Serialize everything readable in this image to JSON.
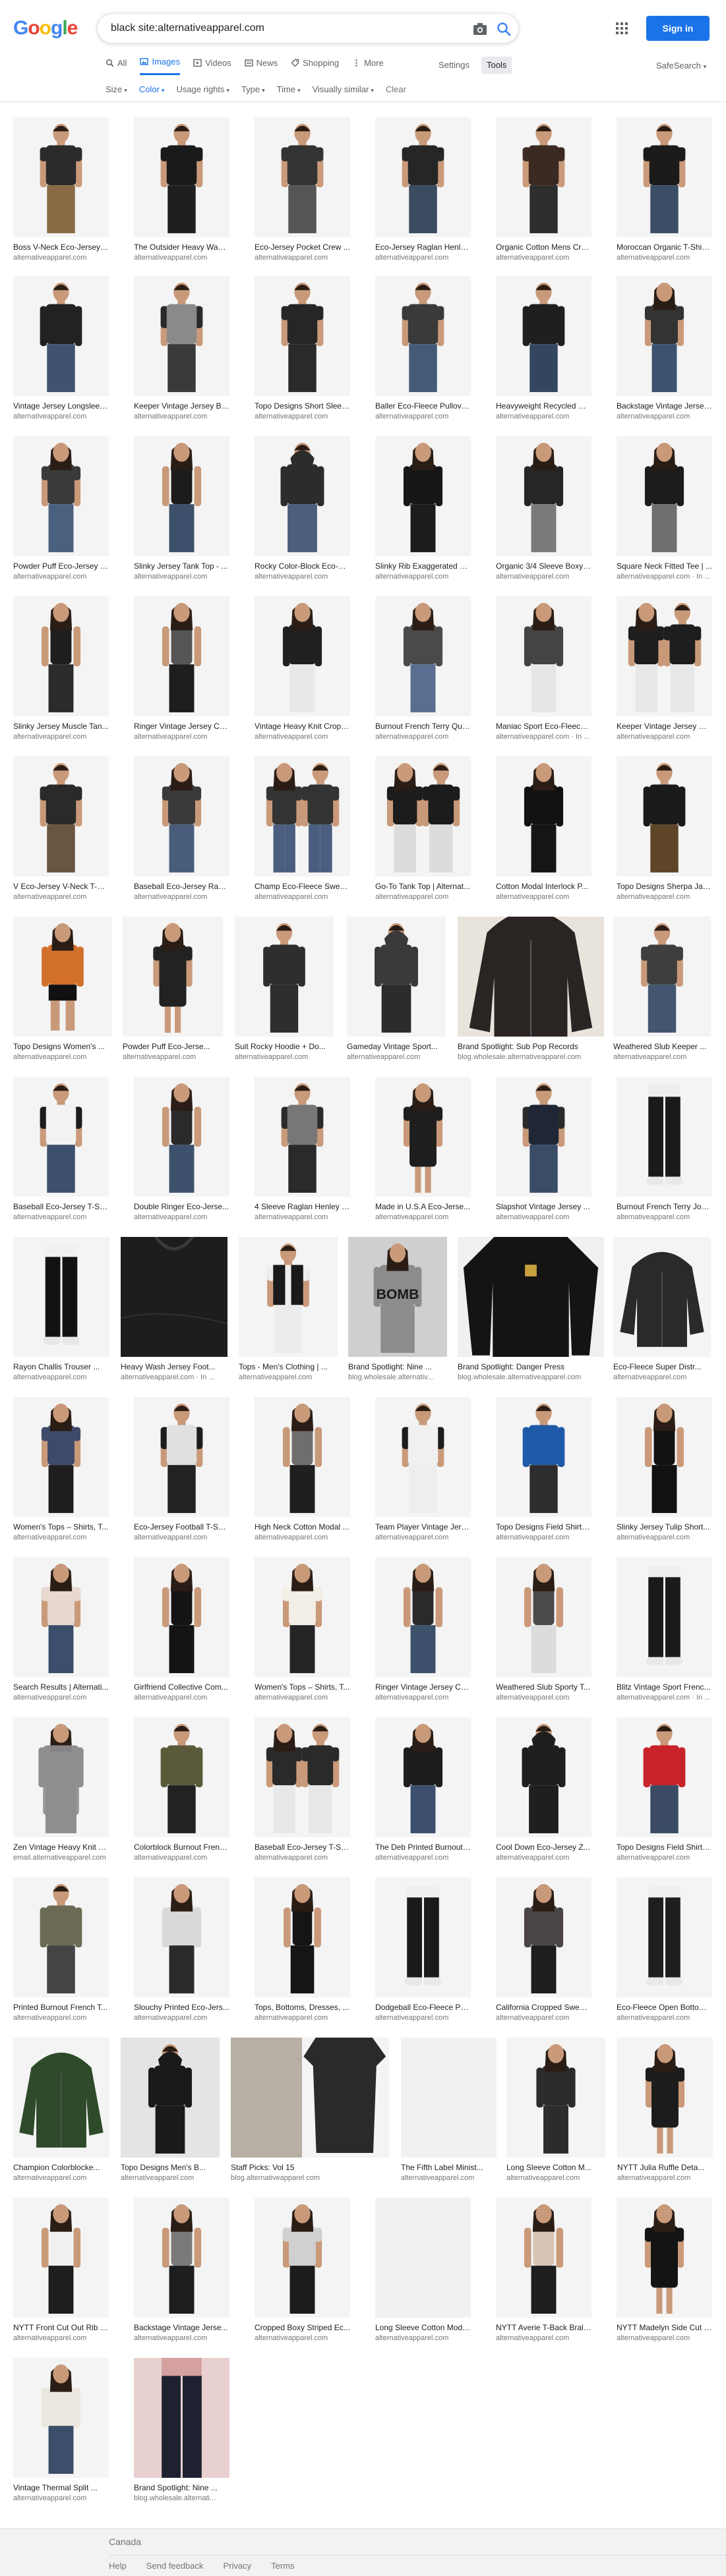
{
  "logo": {
    "letters": [
      [
        "G",
        "#4285f4"
      ],
      [
        "o",
        "#ea4335"
      ],
      [
        "o",
        "#fbbc05"
      ],
      [
        "g",
        "#4285f4"
      ],
      [
        "l",
        "#34a853"
      ],
      [
        "e",
        "#ea4335"
      ]
    ]
  },
  "search": {
    "query": "black site:alternativeapparel.com"
  },
  "header": {
    "signin_label": "Sign in"
  },
  "tabs": [
    {
      "label": "All",
      "icon": "search-icon",
      "active": false
    },
    {
      "label": "Images",
      "icon": "image-icon",
      "active": true
    },
    {
      "label": "Videos",
      "icon": "video-icon",
      "active": false
    },
    {
      "label": "News",
      "icon": "news-icon",
      "active": false
    },
    {
      "label": "Shopping",
      "icon": "tag-icon",
      "active": false
    },
    {
      "label": "More",
      "icon": "more-icon",
      "active": false
    }
  ],
  "tools": {
    "settings": "Settings",
    "tools": "Tools",
    "safesearch": "SafeSearch"
  },
  "filters": [
    {
      "label": "Size",
      "selected": false
    },
    {
      "label": "Color",
      "selected": true
    },
    {
      "label": "Usage rights",
      "selected": false
    },
    {
      "label": "Type",
      "selected": false
    },
    {
      "label": "Time",
      "selected": false
    },
    {
      "label": "Visually similar",
      "selected": false
    }
  ],
  "clear_label": "Clear",
  "rows": [
    [
      {
        "cap": "Boss V-Neck Eco-Jersey ...",
        "src": "alternativeapparel.com",
        "kind": "tee",
        "shirt": "#2b2b2b",
        "pants": "#8a6b45",
        "bg": "#f4f4f4"
      },
      {
        "cap": "The Outsider Heavy Wash...",
        "src": "alternativeapparel.com",
        "kind": "tee",
        "shirt": "#1a1a1a",
        "pants": "#1f1f1f",
        "bg": "#f4f4f4"
      },
      {
        "cap": "Eco-Jersey Pocket Crew ...",
        "src": "alternativeapparel.com",
        "kind": "tee",
        "shirt": "#333333",
        "pants": "#555555",
        "bg": "#f4f4f4"
      },
      {
        "cap": "Eco-Jersey Raglan Henle...",
        "src": "alternativeapparel.com",
        "kind": "tee",
        "shirt": "#262626",
        "pants": "#3a4a60",
        "bg": "#f4f4f4"
      },
      {
        "cap": "Organic Cotton Mens Cre...",
        "src": "alternativeapparel.com",
        "kind": "tee",
        "shirt": "#3b2a22",
        "pants": "#2d2d2d",
        "bg": "#f4f4f4"
      },
      {
        "cap": "Moroccan Organic T-Shirt...",
        "src": "alternativeapparel.com",
        "kind": "tee",
        "shirt": "#1b1b1b",
        "pants": "#3c4e66",
        "bg": "#f4f4f4"
      }
    ],
    [
      {
        "cap": "Vintage Jersey Longsleev...",
        "src": "alternativeapparel.com",
        "kind": "long",
        "shirt": "#222222",
        "pants": "#3f5270",
        "bg": "#f4f4f4"
      },
      {
        "cap": "Keeper Vintage Jersey Ba...",
        "src": "alternativeapparel.com",
        "kind": "raglan",
        "shirt": "#8a8a8a",
        "pants": "#3a3a3a",
        "bg": "#f4f4f4"
      },
      {
        "cap": "Topo Designs Short Sleev...",
        "src": "alternativeapparel.com",
        "kind": "tee",
        "shirt": "#262626",
        "pants": "#2a2a2a",
        "bg": "#f4f4f4"
      },
      {
        "cap": "Baller Eco-Fleece Pullove...",
        "src": "alternativeapparel.com",
        "kind": "tee",
        "shirt": "#3a3a3a",
        "pants": "#455a78",
        "bg": "#f4f4f4"
      },
      {
        "cap": "Heavyweight Recycled Co...",
        "src": "alternativeapparel.com",
        "kind": "long",
        "shirt": "#1f1f1f",
        "pants": "#34465f",
        "bg": "#f4f4f4"
      },
      {
        "cap": "Backstage Vintage Jersey...",
        "src": "alternativeapparel.com",
        "kind": "woman",
        "shirt": "#333333",
        "pants": "#3d5270",
        "bg": "#f4f4f4"
      }
    ],
    [
      {
        "cap": "Powder Puff Eco-Jersey T...",
        "src": "alternativeapparel.com",
        "kind": "woman",
        "shirt": "#3a3a3a",
        "pants": "#4a607f",
        "bg": "#f4f4f4"
      },
      {
        "cap": "Slinky Jersey Tank Top - ...",
        "src": "alternativeapparel.com",
        "kind": "tank",
        "shirt": "#1c1c1c",
        "pants": "#3c4f6b",
        "bg": "#f4f4f4"
      },
      {
        "cap": "Rocky Color-Block Eco-Fl...",
        "src": "alternativeapparel.com",
        "kind": "hoodie",
        "shirt": "#2c2c2c",
        "pants": "#4b5e7c",
        "bg": "#f4f4f4"
      },
      {
        "cap": "Slinky Rib Exaggerated H...",
        "src": "alternativeapparel.com",
        "kind": "woman-long",
        "shirt": "#161616",
        "pants": "#1c1c1c",
        "bg": "#f4f4f4"
      },
      {
        "cap": "Organic 3/4 Sleeve Boxy ...",
        "src": "alternativeapparel.com",
        "kind": "woman-long",
        "shirt": "#262626",
        "pants": "#7a7a7a",
        "bg": "#f4f4f4"
      },
      {
        "cap": "Square Neck Fitted Tee | ...",
        "src": "alternativeapparel.com · In ...",
        "kind": "woman-long",
        "shirt": "#1c1c1c",
        "pants": "#6f6f6f",
        "bg": "#f4f4f4"
      }
    ],
    [
      {
        "cap": "Slinky Jersey Muscle Tan...",
        "src": "alternativeapparel.com",
        "kind": "tank",
        "shirt": "#1f1f1f",
        "pants": "#2b2b2b",
        "bg": "#f4f4f4"
      },
      {
        "cap": "Ringer Vintage Jersey Ca...",
        "src": "alternativeapparel.com",
        "kind": "tank",
        "shirt": "#555555",
        "pants": "#1e1e1e",
        "bg": "#f4f4f4"
      },
      {
        "cap": "Vintage Heavy Knit Cropp...",
        "src": "alternativeapparel.com",
        "kind": "woman-long",
        "shirt": "#202020",
        "pants": "#e8e8e8",
        "bg": "#f4f4f4"
      },
      {
        "cap": "Burnout French Terry Qua...",
        "src": "alternativeapparel.com",
        "kind": "woman-long",
        "shirt": "#4a4a4a",
        "pants": "#5a6f8f",
        "bg": "#f4f4f4"
      },
      {
        "cap": "Maniac Sport Eco-Fleece ...",
        "src": "alternativeapparel.com · In ...",
        "kind": "woman-long",
        "shirt": "#444444",
        "pants": "#e6e6e6",
        "bg": "#f4f4f4"
      },
      {
        "cap": "Keeper Vintage Jersey Cr...",
        "src": "alternativeapparel.com",
        "kind": "pair",
        "shirt": "#1e1e1e",
        "pants": "#e8e8e8",
        "bg": "#f4f4f4"
      }
    ],
    [
      {
        "cap": "V Eco-Jersey V-Neck T-S...",
        "src": "alternativeapparel.com",
        "kind": "tee",
        "shirt": "#2a2a2a",
        "pants": "#6a5540",
        "bg": "#f4f4f4"
      },
      {
        "cap": "Baseball Eco-Jersey Ragl...",
        "src": "alternativeapparel.com",
        "kind": "woman",
        "shirt": "#3a3a3a",
        "pants": "#485d7a",
        "bg": "#f4f4f4"
      },
      {
        "cap": "Champ Eco-Fleece Sweat...",
        "src": "alternativeapparel.com",
        "kind": "pair",
        "shirt": "#333333",
        "pants": "#4a5f7f",
        "bg": "#f4f4f4"
      },
      {
        "cap": "Go-To Tank Top | Alternat...",
        "src": "alternativeapparel.com",
        "kind": "pair",
        "shirt": "#1c1c1c",
        "pants": "#dcdcdc",
        "bg": "#f4f4f4"
      },
      {
        "cap": "Cotton Modal Interlock P...",
        "src": "alternativeapparel.com",
        "kind": "woman-long",
        "shirt": "#111111",
        "pants": "#151515",
        "bg": "#f4f4f4"
      },
      {
        "cap": "Topo Designs Sherpa Jac...",
        "src": "alternativeapparel.com",
        "kind": "long",
        "shirt": "#1a1a1a",
        "pants": "#5e4528",
        "bg": "#f4f4f4"
      }
    ],
    [
      {
        "cap": "Topo Designs Women's ...",
        "src": "alternativeapparel.com",
        "kind": "shorts",
        "shirt": "#d2702c",
        "pants": "#111111",
        "bg": "#f4f4f4"
      },
      {
        "cap": "Powder Puff Eco-Jerse...",
        "src": "alternativeapparel.com",
        "kind": "dress",
        "shirt": "#222222",
        "pants": "#222222",
        "bg": "#f4f4f4"
      },
      {
        "cap": "Suit Rocky Hoodie + Do...",
        "src": "alternativeapparel.com",
        "kind": "long",
        "shirt": "#2e2e2e",
        "pants": "#2e2e2e",
        "bg": "#f4f4f4"
      },
      {
        "cap": "Gameday Vintage Sport...",
        "src": "alternativeapparel.com",
        "kind": "hoodie",
        "shirt": "#3a3a3a",
        "pants": "#2c2c2c",
        "bg": "#f4f4f4"
      },
      {
        "cap": "Brand Spotlight: Sub Pop Records",
        "src": "blog.wholesale.alternativeapparel.com",
        "kind": "flat-hoodie",
        "shirt": "#2a2522",
        "pants": "#2a2522",
        "bg": "#e8e4dc"
      },
      {
        "cap": "Weathered Slub Keeper ...",
        "src": "alternativeapparel.com",
        "kind": "tee",
        "shirt": "#3e3e3e",
        "pants": "#42566f",
        "bg": "#f4f4f4"
      }
    ],
    [
      {
        "cap": "Baseball Eco-Jersey T-Sh...",
        "src": "alternativeapparel.com",
        "kind": "raglan",
        "shirt": "#f2f2f2",
        "pants": "#3d506b",
        "bg": "#f4f4f4"
      },
      {
        "cap": "Double Ringer Eco-Jerse...",
        "src": "alternativeapparel.com",
        "kind": "tank",
        "shirt": "#2a2a2a",
        "pants": "#3e516c",
        "bg": "#f4f4f4"
      },
      {
        "cap": "4 Sleeve Raglan Henley S...",
        "src": "alternativeapparel.com",
        "kind": "raglan",
        "shirt": "#777777",
        "pants": "#2a2a2a",
        "bg": "#f4f4f4"
      },
      {
        "cap": "Made in U.S.A Eco-Jerse...",
        "src": "alternativeapparel.com",
        "kind": "dress",
        "shirt": "#1e1e1e",
        "pants": "#1e1e1e",
        "bg": "#f4f4f4"
      },
      {
        "cap": "Slapshot Vintage Jersey ...",
        "src": "alternativeapparel.com",
        "kind": "raglan",
        "shirt": "#1f2636",
        "pants": "#3b4d66",
        "bg": "#f4f4f4"
      },
      {
        "cap": "Burnout French Terry Jog...",
        "src": "alternativeapparel.com",
        "kind": "jogger",
        "shirt": "#eeeeee",
        "pants": "#1a1a1a",
        "bg": "#f4f4f4"
      }
    ],
    [
      {
        "cap": "Rayon Challis Trouser ...",
        "src": "alternativeapparel.com",
        "kind": "jogger",
        "shirt": "#f0f0f0",
        "pants": "#121212",
        "bg": "#f4f4f4"
      },
      {
        "cap": "Heavy Wash Jersey Foot...",
        "src": "alternativeapparel.com · In ...",
        "kind": "closeup",
        "shirt": "#1d1d1d",
        "pants": "#1d1d1d",
        "bg": "#2a2a2a"
      },
      {
        "cap": "Tops - Men's Clothing | ...",
        "src": "alternativeapparel.com",
        "kind": "vest",
        "shirt": "#1a1a1a",
        "pants": "#ececec",
        "bg": "#f4f4f4"
      },
      {
        "cap": "Brand Spotlight: Nine ...",
        "src": "blog.wholesale.alternativ...",
        "kind": "bomb",
        "shirt": "#8c8c8c",
        "pants": "#8c8c8c",
        "bg": "#cfcfcf"
      },
      {
        "cap": "Brand Spotlight: Danger Press",
        "src": "blog.wholesale.alternativeapparel.com",
        "kind": "flat-long",
        "shirt": "#141414",
        "pants": "#141414",
        "bg": "#f0f0f0"
      },
      {
        "cap": "Eco-Fleece Super Distr...",
        "src": "alternativeapparel.com",
        "kind": "flat-hoodie",
        "shirt": "#2a2a2a",
        "pants": "#2a2a2a",
        "bg": "#f4f4f4"
      }
    ],
    [
      {
        "cap": "Women's Tops – Shirts, T...",
        "src": "alternativeapparel.com",
        "kind": "woman",
        "shirt": "#3f4a6a",
        "pants": "#1e1e1e",
        "bg": "#f4f4f4"
      },
      {
        "cap": "Eco-Jersey Football T-Shi...",
        "src": "alternativeapparel.com",
        "kind": "raglan",
        "shirt": "#e0e0e0",
        "pants": "#222222",
        "bg": "#f4f4f4"
      },
      {
        "cap": "High Neck Cotton Modal ...",
        "src": "alternativeapparel.com",
        "kind": "tank",
        "shirt": "#6e6e6e",
        "pants": "#1f1f1f",
        "bg": "#f4f4f4"
      },
      {
        "cap": "Team Player Vintage Jers...",
        "src": "alternativeapparel.com",
        "kind": "raglan",
        "shirt": "#f0f0f0",
        "pants": "#eeeeee",
        "bg": "#f4f4f4"
      },
      {
        "cap": "Topo Designs Field Shirt |...",
        "src": "alternativeapparel.com",
        "kind": "long",
        "shirt": "#1f5aa8",
        "pants": "#2d2d2d",
        "bg": "#f4f4f4"
      },
      {
        "cap": "Slinky Jersey Tulip Short...",
        "src": "alternativeapparel.com",
        "kind": "tank",
        "shirt": "#111111",
        "pants": "#111111",
        "bg": "#f4f4f4"
      }
    ],
    [
      {
        "cap": "Search Results | Alternati...",
        "src": "alternativeapparel.com",
        "kind": "woman",
        "shirt": "#e8d8d0",
        "pants": "#3b4e6b",
        "bg": "#f4f4f4"
      },
      {
        "cap": "Girlfriend Collective Com...",
        "src": "alternativeapparel.com",
        "kind": "tank",
        "shirt": "#141414",
        "pants": "#141414",
        "bg": "#f4f4f4"
      },
      {
        "cap": "Women's Tops – Shirts, T...",
        "src": "alternativeapparel.com",
        "kind": "woman",
        "shirt": "#f3eee6",
        "pants": "#242424",
        "bg": "#f4f4f4"
      },
      {
        "cap": "Ringer Vintage Jersey Ca...",
        "src": "alternativeapparel.com",
        "kind": "tank",
        "shirt": "#2a2a2a",
        "pants": "#3e516c",
        "bg": "#f4f4f4"
      },
      {
        "cap": "Weathered Slub Sporty T...",
        "src": "alternativeapparel.com",
        "kind": "tank",
        "shirt": "#4a4a4a",
        "pants": "#dcdcdc",
        "bg": "#f4f4f4"
      },
      {
        "cap": "Blitz Vintage Sport Frenc...",
        "src": "alternativeapparel.com · In ...",
        "kind": "jogger",
        "shirt": "#eeeeee",
        "pants": "#1a1a1a",
        "bg": "#f4f4f4"
      }
    ],
    [
      {
        "cap": "Zen Vintage Heavy Knit W...",
        "src": "email.alternativeapparel.com",
        "kind": "cardigan",
        "shirt": "#8e8e8e",
        "pants": "#8e8e8e",
        "bg": "#f4f4f4"
      },
      {
        "cap": "Colorblock Burnout Frenc...",
        "src": "alternativeapparel.com",
        "kind": "long",
        "shirt": "#5a5a3a",
        "pants": "#222222",
        "bg": "#f4f4f4"
      },
      {
        "cap": "Baseball Eco-Jersey T-Sh...",
        "src": "alternativeapparel.com",
        "kind": "pair",
        "shirt": "#2a2a2a",
        "pants": "#e8e8e8",
        "bg": "#f4f4f4"
      },
      {
        "cap": "The Deb Printed Burnout ...",
        "src": "alternativeapparel.com",
        "kind": "woman-long",
        "shirt": "#1d1d1d",
        "pants": "#3c506e",
        "bg": "#f4f4f4"
      },
      {
        "cap": "Cool Down Eco-Jersey Z...",
        "src": "alternativeapparel.com",
        "kind": "hoodie",
        "shirt": "#1f1f1f",
        "pants": "#1f1f1f",
        "bg": "#f4f4f4"
      },
      {
        "cap": "Topo Designs Field Shirt |...",
        "src": "alternativeapparel.com",
        "kind": "long",
        "shirt": "#c8222a",
        "pants": "#3a4b63",
        "bg": "#f4f4f4"
      }
    ],
    [
      {
        "cap": "Printed Burnout French T...",
        "src": "alternativeapparel.com",
        "kind": "long",
        "shirt": "#6b6b55",
        "pants": "#444444",
        "bg": "#f4f4f4"
      },
      {
        "cap": "Slouchy Printed Eco-Jers...",
        "src": "alternativeapparel.com",
        "kind": "woman-long",
        "shirt": "#d9d9d9",
        "pants": "#2a2a2a",
        "bg": "#f4f4f4"
      },
      {
        "cap": "Tops, Bottoms, Dresses, ...",
        "src": "alternativeapparel.com",
        "kind": "jumpsuit",
        "shirt": "#151515",
        "pants": "#151515",
        "bg": "#f4f4f4"
      },
      {
        "cap": "Dodgeball Eco-Fleece Pa...",
        "src": "alternativeapparel.com",
        "kind": "jogger",
        "shirt": "#efefef",
        "pants": "#1a1a1a",
        "bg": "#f4f4f4"
      },
      {
        "cap": "California Cropped Sweat...",
        "src": "alternativeapparel.com",
        "kind": "woman-long",
        "shirt": "#4a4444",
        "pants": "#1e1e1e",
        "bg": "#f4f4f4"
      },
      {
        "cap": "Eco-Fleece Open Bottom ...",
        "src": "alternativeapparel.com",
        "kind": "jogger",
        "shirt": "#efefef",
        "pants": "#1e1e1e",
        "bg": "#f4f4f4"
      }
    ],
    [
      {
        "cap": "Champion Colorblocke...",
        "src": "alternativeapparel.com",
        "kind": "flat-hoodie",
        "shirt": "#2e4a2a",
        "pants": "#2e4a2a",
        "bg": "#f4f4f4"
      },
      {
        "cap": "Topo Designs Men's B...",
        "src": "alternativeapparel.com",
        "kind": "hoodie",
        "shirt": "#1a1a1a",
        "pants": "#1a1a1a",
        "bg": "#e4e4e4"
      },
      {
        "cap": "Staff Picks: Vol 15",
        "src": "blog.alternativeapparel.com",
        "kind": "staff",
        "shirt": "#2a2a2a",
        "pants": "#2a2a2a",
        "bg": "#f4f4f4"
      },
      {
        "cap": "The Fifth Label Minist...",
        "src": "alternativeapparel.com",
        "kind": "blank",
        "shirt": "#eeeeee",
        "pants": "#eeeeee",
        "bg": "#f1f1f1"
      },
      {
        "cap": "Long Sleeve Cotton M...",
        "src": "alternativeapparel.com",
        "kind": "woman-long",
        "shirt": "#2c2c2c",
        "pants": "#2c2c2c",
        "bg": "#f4f4f4"
      },
      {
        "cap": "NYTT Julia Ruffle Deta...",
        "src": "alternativeapparel.com",
        "kind": "dress",
        "shirt": "#1c1c1c",
        "pants": "#1c1c1c",
        "bg": "#f4f4f4"
      }
    ],
    [
      {
        "cap": "NYTT Front Cut Out Rib B...",
        "src": "alternativeapparel.com",
        "kind": "tank",
        "shirt": "#f0f0f0",
        "pants": "#1e1e1e",
        "bg": "#f4f4f4"
      },
      {
        "cap": "Backstage Vintage Jerse...",
        "src": "alternativeapparel.com",
        "kind": "tank",
        "shirt": "#7a7a7a",
        "pants": "#1e1e1e",
        "bg": "#f4f4f4"
      },
      {
        "cap": "Cropped Boxy Striped Ec...",
        "src": "alternativeapparel.com",
        "kind": "woman",
        "shirt": "#d0d0d0",
        "pants": "#1c1c1c",
        "bg": "#f4f4f4"
      },
      {
        "cap": "Long Sleeve Cotton Moda...",
        "src": "alternativeapparel.com",
        "kind": "blank",
        "shirt": "#eeeeee",
        "pants": "#eeeeee",
        "bg": "#f1f1f1"
      },
      {
        "cap": "NYTT Averie T-Back Brale...",
        "src": "alternativeapparel.com",
        "kind": "tank",
        "shirt": "#d8c4b4",
        "pants": "#1e1e1e",
        "bg": "#f4f4f4"
      },
      {
        "cap": "NYTT Madelyn Side Cut T...",
        "src": "alternativeapparel.com",
        "kind": "dress",
        "shirt": "#141414",
        "pants": "#141414",
        "bg": "#f4f4f4"
      }
    ],
    [
      {
        "cap": "Vintage Thermal Split ...",
        "src": "alternativeapparel.com",
        "kind": "woman-long",
        "shirt": "#ece8df",
        "pants": "#3b4e6a",
        "bg": "#f4f4f4"
      },
      {
        "cap": "Brand Spotlight: Nine ...",
        "src": "blog.wholesale.alternati...",
        "kind": "jeans",
        "shirt": "#d4a0a0",
        "pants": "#1e2230",
        "bg": "#e8d0d0"
      }
    ]
  ],
  "footer": {
    "country": "Canada",
    "links": [
      "Help",
      "Send feedback",
      "Privacy",
      "Terms"
    ]
  }
}
